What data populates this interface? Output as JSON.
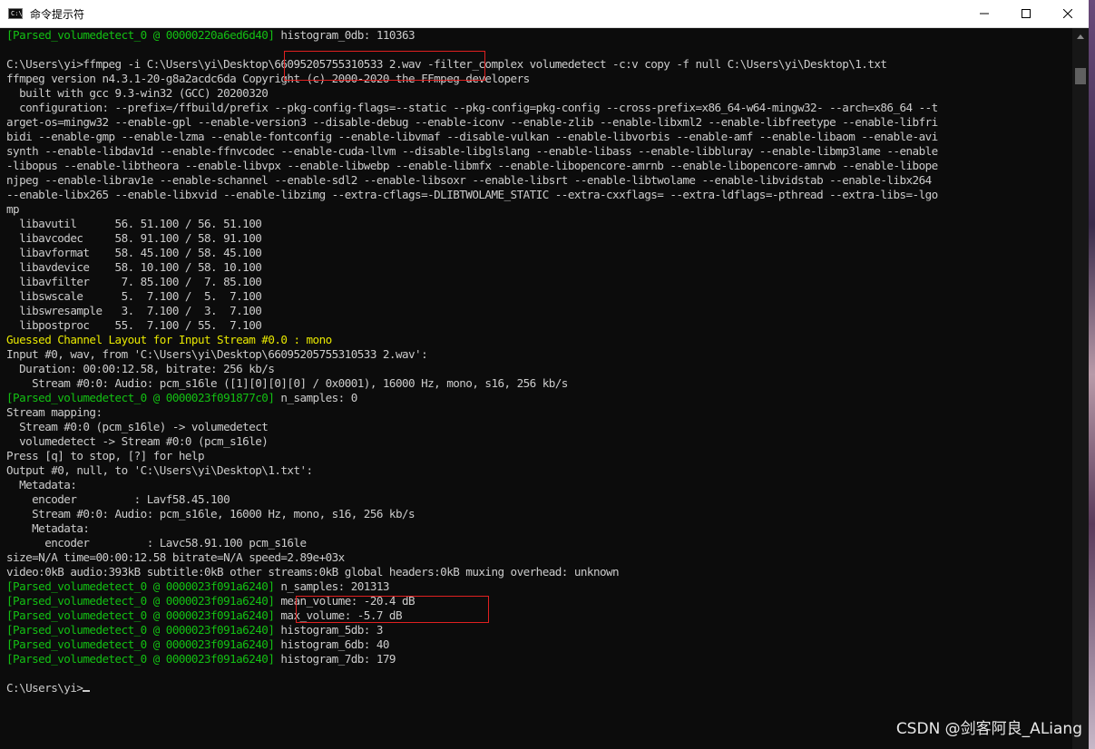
{
  "window": {
    "title": "命令提示符",
    "icon_text": "C:\\",
    "icon": "cmd-icon",
    "controls": [
      "minimize-icon",
      "maximize-icon",
      "close-icon"
    ]
  },
  "colors": {
    "background": "#0c0c0c",
    "text": "#cccccc",
    "green": "#13c013",
    "yellow": "#e8e800",
    "highlight_box": "#e02020"
  },
  "console": {
    "lines": [
      [
        {
          "t": "[Parsed_volumedetect_0 @ 00000220a6ed6d40]",
          "c": "g"
        },
        {
          "t": " histogram_0db: 110363",
          "c": "w"
        }
      ],
      [
        {
          "t": "",
          "c": "w"
        }
      ],
      [
        {
          "t": "C:\\Users\\yi>ffmpeg -i C:\\Users\\yi\\Desktop\\66095205755310533 2.wav -filter_complex volumedetect -c:v copy -f null C:\\Users\\yi\\Desktop\\1.txt",
          "c": "w"
        }
      ],
      [
        {
          "t": "ffmpeg version n4.3.1-20-g8a2acdc6da Copyright (c) 2000-2020 the FFmpeg developers",
          "c": "w"
        }
      ],
      [
        {
          "t": "  built with gcc 9.3-win32 (GCC) 20200320",
          "c": "w"
        }
      ],
      [
        {
          "t": "  configuration: --prefix=/ffbuild/prefix --pkg-config-flags=--static --pkg-config=pkg-config --cross-prefix=x86_64-w64-mingw32- --arch=x86_64 --t",
          "c": "w"
        }
      ],
      [
        {
          "t": "arget-os=mingw32 --enable-gpl --enable-version3 --disable-debug --enable-iconv --enable-zlib --enable-libxml2 --enable-libfreetype --enable-libfri",
          "c": "w"
        }
      ],
      [
        {
          "t": "bidi --enable-gmp --enable-lzma --enable-fontconfig --enable-libvmaf --disable-vulkan --enable-libvorbis --enable-amf --enable-libaom --enable-avi",
          "c": "w"
        }
      ],
      [
        {
          "t": "synth --enable-libdav1d --enable-ffnvcodec --enable-cuda-llvm --disable-libglslang --enable-libass --enable-libbluray --enable-libmp3lame --enable",
          "c": "w"
        }
      ],
      [
        {
          "t": "-libopus --enable-libtheora --enable-libvpx --enable-libwebp --enable-libmfx --enable-libopencore-amrnb --enable-libopencore-amrwb --enable-libope",
          "c": "w"
        }
      ],
      [
        {
          "t": "njpeg --enable-librav1e --enable-schannel --enable-sdl2 --enable-libsoxr --enable-libsrt --enable-libtwolame --enable-libvidstab --enable-libx264",
          "c": "w"
        }
      ],
      [
        {
          "t": "--enable-libx265 --enable-libxvid --enable-libzimg --extra-cflags=-DLIBTWOLAME_STATIC --extra-cxxflags= --extra-ldflags=-pthread --extra-libs=-lgo",
          "c": "w"
        }
      ],
      [
        {
          "t": "mp",
          "c": "w"
        }
      ],
      [
        {
          "t": "  libavutil      56. 51.100 / 56. 51.100",
          "c": "w"
        }
      ],
      [
        {
          "t": "  libavcodec     58. 91.100 / 58. 91.100",
          "c": "w"
        }
      ],
      [
        {
          "t": "  libavformat    58. 45.100 / 58. 45.100",
          "c": "w"
        }
      ],
      [
        {
          "t": "  libavdevice    58. 10.100 / 58. 10.100",
          "c": "w"
        }
      ],
      [
        {
          "t": "  libavfilter     7. 85.100 /  7. 85.100",
          "c": "w"
        }
      ],
      [
        {
          "t": "  libswscale      5.  7.100 /  5.  7.100",
          "c": "w"
        }
      ],
      [
        {
          "t": "  libswresample   3.  7.100 /  3.  7.100",
          "c": "w"
        }
      ],
      [
        {
          "t": "  libpostproc    55.  7.100 / 55.  7.100",
          "c": "w"
        }
      ],
      [
        {
          "t": "Guessed Channel Layout for Input Stream #0.0 : mono",
          "c": "y"
        }
      ],
      [
        {
          "t": "Input #0, wav, from 'C:\\Users\\yi\\Desktop\\66095205755310533 2.wav':",
          "c": "w"
        }
      ],
      [
        {
          "t": "  Duration: 00:00:12.58, bitrate: 256 kb/s",
          "c": "w"
        }
      ],
      [
        {
          "t": "    Stream #0:0: Audio: pcm_s16le ([1][0][0][0] / 0x0001), 16000 Hz, mono, s16, 256 kb/s",
          "c": "w"
        }
      ],
      [
        {
          "t": "[Parsed_volumedetect_0 @ 0000023f091877c0]",
          "c": "g"
        },
        {
          "t": " n_samples: 0",
          "c": "w"
        }
      ],
      [
        {
          "t": "Stream mapping:",
          "c": "w"
        }
      ],
      [
        {
          "t": "  Stream #0:0 (pcm_s16le) -> volumedetect",
          "c": "w"
        }
      ],
      [
        {
          "t": "  volumedetect -> Stream #0:0 (pcm_s16le)",
          "c": "w"
        }
      ],
      [
        {
          "t": "Press [q] to stop, [?] for help",
          "c": "w"
        }
      ],
      [
        {
          "t": "Output #0, null, to 'C:\\Users\\yi\\Desktop\\1.txt':",
          "c": "w"
        }
      ],
      [
        {
          "t": "  Metadata:",
          "c": "w"
        }
      ],
      [
        {
          "t": "    encoder         : Lavf58.45.100",
          "c": "w"
        }
      ],
      [
        {
          "t": "    Stream #0:0: Audio: pcm_s16le, 16000 Hz, mono, s16, 256 kb/s",
          "c": "w"
        }
      ],
      [
        {
          "t": "    Metadata:",
          "c": "w"
        }
      ],
      [
        {
          "t": "      encoder         : Lavc58.91.100 pcm_s16le",
          "c": "w"
        }
      ],
      [
        {
          "t": "size=N/A time=00:00:12.58 bitrate=N/A speed=2.89e+03x",
          "c": "w"
        }
      ],
      [
        {
          "t": "video:0kB audio:393kB subtitle:0kB other streams:0kB global headers:0kB muxing overhead: unknown",
          "c": "w"
        }
      ],
      [
        {
          "t": "[Parsed_volumedetect_0 @ 0000023f091a6240]",
          "c": "g"
        },
        {
          "t": " n_samples: 201313",
          "c": "w"
        }
      ],
      [
        {
          "t": "[Parsed_volumedetect_0 @ 0000023f091a6240]",
          "c": "g"
        },
        {
          "t": " mean_volume: -20.4 dB",
          "c": "w"
        }
      ],
      [
        {
          "t": "[Parsed_volumedetect_0 @ 0000023f091a6240]",
          "c": "g"
        },
        {
          "t": " max_volume: -5.7 dB",
          "c": "w"
        }
      ],
      [
        {
          "t": "[Parsed_volumedetect_0 @ 0000023f091a6240]",
          "c": "g"
        },
        {
          "t": " histogram_5db: 3",
          "c": "w"
        }
      ],
      [
        {
          "t": "[Parsed_volumedetect_0 @ 0000023f091a6240]",
          "c": "g"
        },
        {
          "t": " histogram_6db: 40",
          "c": "w"
        }
      ],
      [
        {
          "t": "[Parsed_volumedetect_0 @ 0000023f091a6240]",
          "c": "g"
        },
        {
          "t": " histogram_7db: 179",
          "c": "w"
        }
      ],
      [
        {
          "t": "",
          "c": "w"
        }
      ],
      [
        {
          "t": "C:\\Users\\yi>",
          "c": "w"
        },
        {
          "cursor": true
        }
      ]
    ]
  },
  "watermark": "CSDN @剑客阿良_ALiang"
}
